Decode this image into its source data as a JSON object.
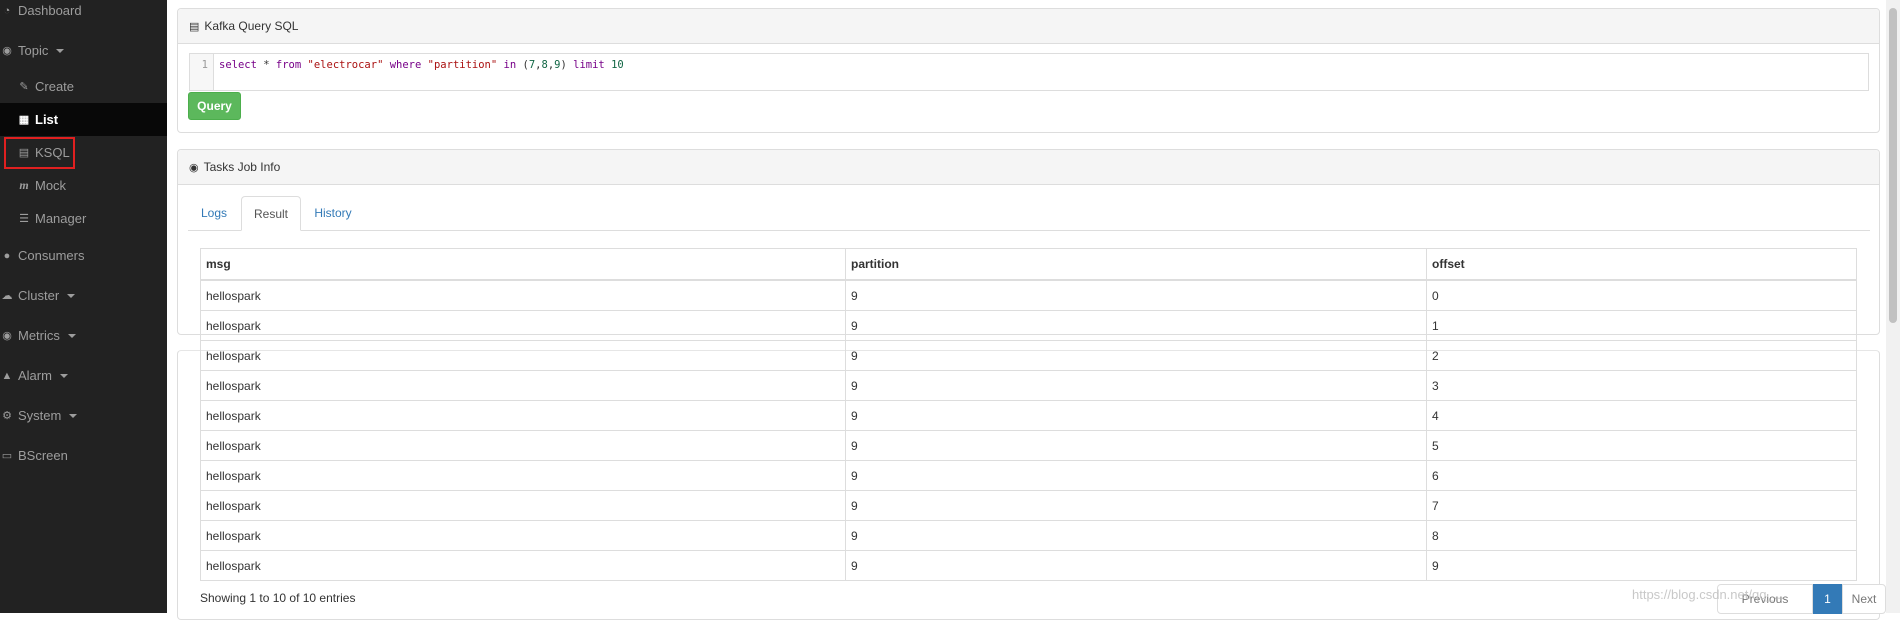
{
  "sidebar": {
    "items": [
      {
        "label": "Dashboard",
        "icon": "dashboard-icon"
      },
      {
        "label": "Topic",
        "icon": "comment-icon"
      },
      {
        "label": "Create",
        "icon": "edit-icon"
      },
      {
        "label": "List",
        "icon": "table-icon"
      },
      {
        "label": "KSQL",
        "icon": "file-icon"
      },
      {
        "label": "Mock",
        "icon": "italic-m-icon"
      },
      {
        "label": "Manager",
        "icon": "tasks-icon"
      },
      {
        "label": "Consumers",
        "icon": "users-icon"
      },
      {
        "label": "Cluster",
        "icon": "cloud-icon"
      },
      {
        "label": "Metrics",
        "icon": "eye-icon"
      },
      {
        "label": "Alarm",
        "icon": "bell-icon"
      },
      {
        "label": "System",
        "icon": "gear-icon"
      },
      {
        "label": "BScreen",
        "icon": "desktop-icon"
      }
    ],
    "active": "List",
    "highlighted": "KSQL"
  },
  "query_panel": {
    "title": "Kafka Query SQL",
    "editor": {
      "line_number": "1",
      "tokens": {
        "t1": "select",
        "t2": " * ",
        "t3": "from",
        "t4": " ",
        "t5": "\"electrocar\"",
        "t6": " ",
        "t7": "where",
        "t8": " ",
        "t9": "\"partition\"",
        "t10": " ",
        "t11": "in",
        "t12": " (",
        "t13": "7",
        "t14": ",",
        "t15": "8",
        "t16": ",",
        "t17": "9",
        "t18": ") ",
        "t19": "limit",
        "t20": " ",
        "t21": "10"
      }
    },
    "query_button": "Query"
  },
  "tasks_panel": {
    "title": "Tasks Job Info",
    "tabs": [
      "Logs",
      "Result",
      "History"
    ],
    "active_tab": "Result",
    "table": {
      "headers": [
        "msg",
        "partition",
        "offset"
      ],
      "rows": [
        [
          "hellospark",
          "9",
          "0"
        ],
        [
          "hellospark",
          "9",
          "1"
        ],
        [
          "hellospark",
          "9",
          "2"
        ],
        [
          "hellospark",
          "9",
          "3"
        ],
        [
          "hellospark",
          "9",
          "4"
        ],
        [
          "hellospark",
          "9",
          "5"
        ],
        [
          "hellospark",
          "9",
          "6"
        ],
        [
          "hellospark",
          "9",
          "7"
        ],
        [
          "hellospark",
          "9",
          "8"
        ],
        [
          "hellospark",
          "9",
          "9"
        ]
      ]
    },
    "info": "Showing 1 to 10 of 10 entries",
    "pagination": {
      "previous": "Previous",
      "current": "1",
      "next": "Next"
    }
  },
  "watermark": "https://blog.csdn.net/qq_...",
  "colors": {
    "sidebar_bg": "#222222",
    "active_bg": "#080808",
    "highlight_border": "#e02020",
    "query_button": "#5cb85c",
    "link": "#337ab7"
  }
}
